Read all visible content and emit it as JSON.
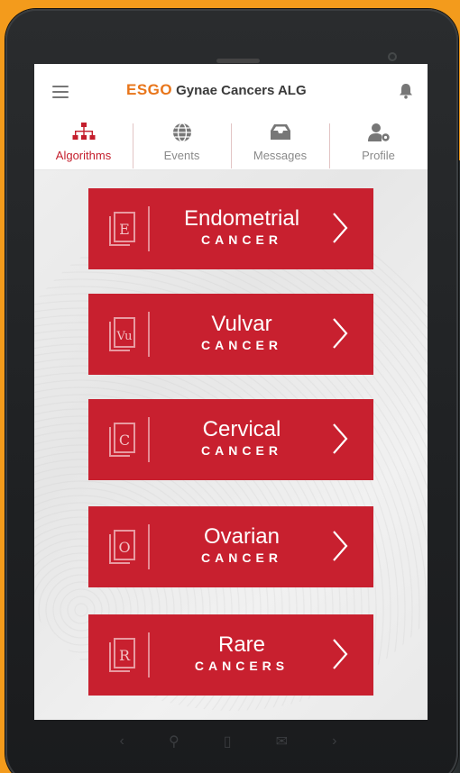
{
  "app": {
    "logo_text": "ESGO",
    "title": "Gynae Cancers ALG"
  },
  "icons": {
    "menu": "hamburger-menu-icon",
    "notifications": "bell-icon"
  },
  "tabs": [
    {
      "label": "Algorithms",
      "icon": "hierarchy-icon",
      "active": true
    },
    {
      "label": "Events",
      "icon": "globe-icon",
      "active": false
    },
    {
      "label": "Messages",
      "icon": "inbox-icon",
      "active": false
    },
    {
      "label": "Profile",
      "icon": "user-settings-icon",
      "active": false
    }
  ],
  "cancers": [
    {
      "name": "Endometrial",
      "sub": "CANCER",
      "icon_letter": "E"
    },
    {
      "name": "Vulvar",
      "sub": "CANCER",
      "icon_letter": "Vu"
    },
    {
      "name": "Cervical",
      "sub": "CANCER",
      "icon_letter": "C"
    },
    {
      "name": "Ovarian",
      "sub": "CANCER",
      "icon_letter": "O"
    },
    {
      "name": "Rare",
      "sub": "CANCERS",
      "icon_letter": "R"
    }
  ],
  "colors": {
    "accent": "#c8202f",
    "brand_orange": "#e8751a",
    "background": "#f39b1c"
  }
}
